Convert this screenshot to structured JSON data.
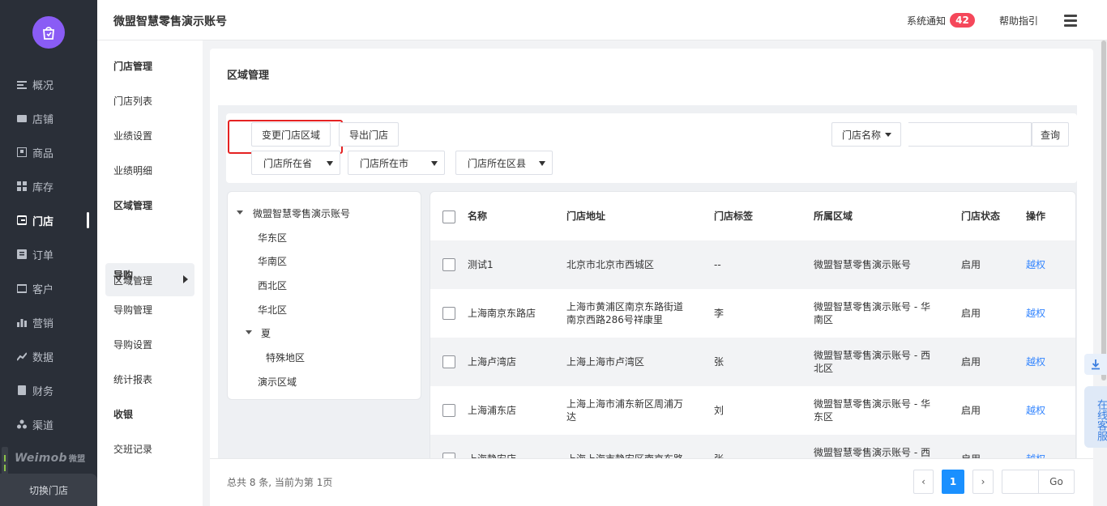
{
  "nav": {
    "items": [
      {
        "label": "概况",
        "icon": "list-icon"
      },
      {
        "label": "店铺",
        "icon": "shop-icon"
      },
      {
        "label": "商品",
        "icon": "goods-icon"
      },
      {
        "label": "库存",
        "icon": "stock-icon"
      },
      {
        "label": "门店",
        "icon": "store-icon",
        "active": true
      },
      {
        "label": "订单",
        "icon": "order-icon"
      },
      {
        "label": "客户",
        "icon": "customer-icon"
      },
      {
        "label": "营销",
        "icon": "marketing-icon"
      },
      {
        "label": "数据",
        "icon": "chart-icon"
      },
      {
        "label": "财务",
        "icon": "finance-icon"
      },
      {
        "label": "渠道",
        "icon": "channel-icon"
      }
    ],
    "brand": "Weimob",
    "brand_cn": "微盟",
    "switch_store": "切换门店"
  },
  "header": {
    "title": "微盟智慧零售演示账号",
    "notice": "系统通知",
    "notice_count": "42",
    "help": "帮助指引"
  },
  "subnav": {
    "items": [
      {
        "label": "门店管理",
        "group": true
      },
      {
        "label": "门店列表"
      },
      {
        "label": "业绩设置"
      },
      {
        "label": "业绩明细"
      },
      {
        "label": "区域管理",
        "group": true
      },
      {
        "label": "导购",
        "group": true
      },
      {
        "label": "导购管理"
      },
      {
        "label": "导购设置"
      },
      {
        "label": "统计报表"
      },
      {
        "label": "收银",
        "group": true
      },
      {
        "label": "交班记录"
      }
    ],
    "active": "区域管理"
  },
  "page": {
    "title": "区域管理",
    "btn_change_region": "变更门店区域",
    "btn_export": "导出门店",
    "search_type": "门店名称",
    "search_btn": "查询",
    "select_province": "门店所在省",
    "select_city": "门店所在市",
    "select_district": "门店所在区县"
  },
  "tree": {
    "root": "微盟智慧零售演示账号",
    "nodes": [
      "华东区",
      "华南区",
      "西北区",
      "华北区"
    ],
    "xia": "夏",
    "xia_child": "特殊地区",
    "demo": "演示区域"
  },
  "table": {
    "headers": [
      "名称",
      "门店地址",
      "门店标签",
      "所属区域",
      "门店状态",
      "操作"
    ],
    "rows": [
      {
        "name": "测试1",
        "addr1": "北京市北京市西城区",
        "addr2": "",
        "tag": "--",
        "region1": "微盟智慧零售演示账号",
        "region2": "",
        "status": "启用",
        "action": "越权"
      },
      {
        "name": "上海南京东路店",
        "addr1": "上海市黄浦区南京东路街道",
        "addr2": "南京西路286号祥康里",
        "tag": "李",
        "region1": "微盟智慧零售演示账号 - 华",
        "region2": "南区",
        "status": "启用",
        "action": "越权"
      },
      {
        "name": "上海卢湾店",
        "addr1": "上海上海市卢湾区",
        "addr2": "",
        "tag": "张",
        "region1": "微盟智慧零售演示账号 - 西",
        "region2": "北区",
        "status": "启用",
        "action": "越权"
      },
      {
        "name": "上海浦东店",
        "addr1": "上海上海市浦东新区周浦万",
        "addr2": "达",
        "tag": "刘",
        "region1": "微盟智慧零售演示账号 - 华",
        "region2": "东区",
        "status": "启用",
        "action": "越权"
      },
      {
        "name": "上海静安店",
        "addr1": "上海上海市静安区南京东路",
        "addr2": "",
        "tag": "张",
        "region1": "微盟智慧零售演示账号 - 西",
        "region2": "",
        "status": "启用",
        "action": "越权"
      }
    ]
  },
  "footer": {
    "total": "总共 8 条, 当前为第 1页",
    "prev": "‹",
    "current": "1",
    "next": "›",
    "go": "Go"
  },
  "float": {
    "customer_service": "在线客服"
  },
  "colors": {
    "sidebar": "#2a2f38",
    "accent": "#1a90ff",
    "link": "#3385ff",
    "badge": "#f5475a",
    "highlight": "#e52222",
    "logo": "#8a5cf5"
  }
}
